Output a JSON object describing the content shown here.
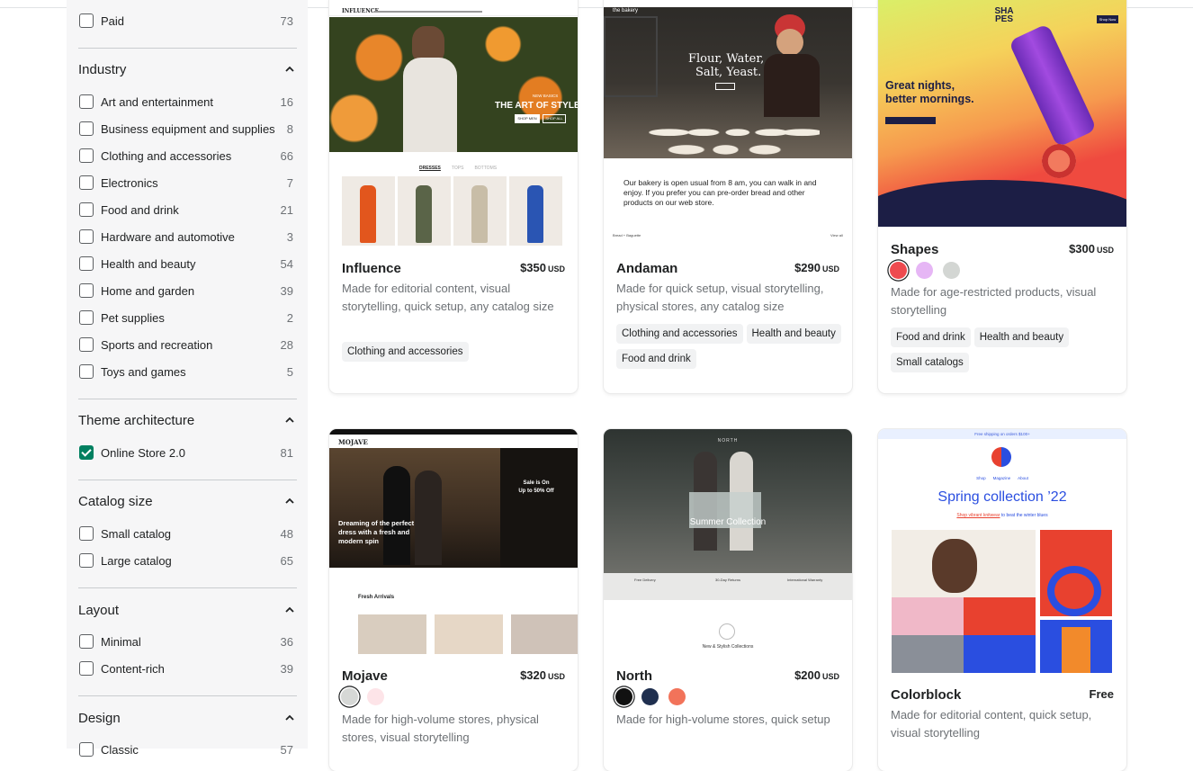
{
  "filters": {
    "paid": {
      "label": "Paid",
      "count": "73"
    },
    "industry": {
      "title": "Industry",
      "items": [
        {
          "label": "Art and entertainment",
          "count": "16"
        },
        {
          "label": "Business equipment and supplies",
          "count": "8"
        },
        {
          "label": "Clothing and accessories",
          "count": "66"
        },
        {
          "label": "Electronics",
          "count": "7"
        },
        {
          "label": "Food and drink",
          "count": "21"
        },
        {
          "label": "Hardware and automotive",
          "count": "3"
        },
        {
          "label": "Health and beauty",
          "count": "54"
        },
        {
          "label": "Home and garden",
          "count": "39"
        },
        {
          "label": "Pet supplies",
          "count": "2"
        },
        {
          "label": "Sports and recreation",
          "count": "28"
        },
        {
          "label": "Toys and games",
          "count": "5"
        }
      ]
    },
    "architecture": {
      "title": "Theme architecture",
      "items": [
        {
          "label": "Online Store 2.0",
          "count": "81",
          "checked": true
        }
      ]
    },
    "catalog": {
      "title": "Catalog size",
      "items": [
        {
          "label": "Small catalog",
          "count": "48"
        },
        {
          "label": "Large catalog",
          "count": "65"
        }
      ]
    },
    "layout": {
      "title": "Layout",
      "items": [
        {
          "label": "Minimal",
          "count": "36"
        },
        {
          "label": "Content-rich",
          "count": "39"
        }
      ]
    },
    "design": {
      "title": "Design",
      "items": [
        {
          "label": "Classic",
          "count": "57"
        }
      ]
    }
  },
  "themes": [
    {
      "name": "Influence",
      "price": "$350",
      "currency": "USD",
      "description": "Made for editorial content, visual storytelling, quick setup, any catalog size",
      "tags": [
        "Clothing and accessories"
      ],
      "preview": {
        "brand": "INFLUENCE",
        "headline": "THE ART OF STYLE",
        "eyebrow": "NEW BASICS",
        "btn1": "SHOP MEN",
        "btn2": "SHOP ALL",
        "tabs": [
          "DRESSES",
          "TOPS",
          "BOTTOMS"
        ]
      }
    },
    {
      "name": "Andaman",
      "price": "$290",
      "currency": "USD",
      "description": "Made for quick setup, visual storytelling, physical stores, any catalog size",
      "tags": [
        "Clothing and accessories",
        "Health and beauty",
        "Food and drink"
      ],
      "preview": {
        "brand": "the bakery",
        "headline1": "Flour, Water,",
        "headline2": "Salt, Yeast.",
        "body": "Our bakery is open usual from 8 am, you can walk in and enjoy. If you prefer you can pre-order bread and other products on our web store.",
        "footer": "Bread + Baguette",
        "link": "View all"
      }
    },
    {
      "name": "Shapes",
      "price": "$300",
      "currency": "USD",
      "description": "Made for age-restricted products, visual storytelling",
      "tags": [
        "Food and drink",
        "Health and beauty",
        "Small catalogs"
      ],
      "swatches": [
        "#ee4a4f",
        "#e6b6f5",
        "#d3d6d3"
      ],
      "preview": {
        "brand": "SHA PES",
        "headline1": "Great nights,",
        "headline2": "better mornings.",
        "btn": "Shop Now"
      }
    },
    {
      "name": "Mojave",
      "price": "$320",
      "currency": "USD",
      "description": "Made for high-volume stores, physical stores, visual storytelling",
      "tags": [],
      "swatches": [
        "#d6d8d6",
        "#fde4e8"
      ],
      "preview": {
        "brand": "MOJAVE",
        "headline": "Dreaming of the perfect dress with a fresh and modern spin",
        "sale1": "Sale is On",
        "sale2": "Up to 50% Off",
        "section": "Fresh Arrivals"
      }
    },
    {
      "name": "North",
      "price": "$200",
      "currency": "USD",
      "description": "Made for high-volume stores, quick setup",
      "tags": [],
      "swatches": [
        "#111111",
        "#1f2f4f",
        "#f2735a"
      ],
      "preview": {
        "brand": "NORTH",
        "headline": "Summer Collection",
        "f1": "Free Delivery",
        "f2": "30-Day Returns",
        "f3": "International Warranty",
        "section": "New & Stylish Collections"
      }
    },
    {
      "name": "Colorblock",
      "price": "Free",
      "currency": "",
      "description": "Made for editorial content, quick setup, visual storytelling",
      "tags": [],
      "preview": {
        "announce": "Free shipping on orders $100+",
        "headline": "Spring collection ’22",
        "sub_link": "Shop vibrant knitwear",
        "sub_rest": " to beat the winter blues",
        "nav": [
          "Shop",
          "Magazine",
          "About"
        ]
      }
    }
  ]
}
